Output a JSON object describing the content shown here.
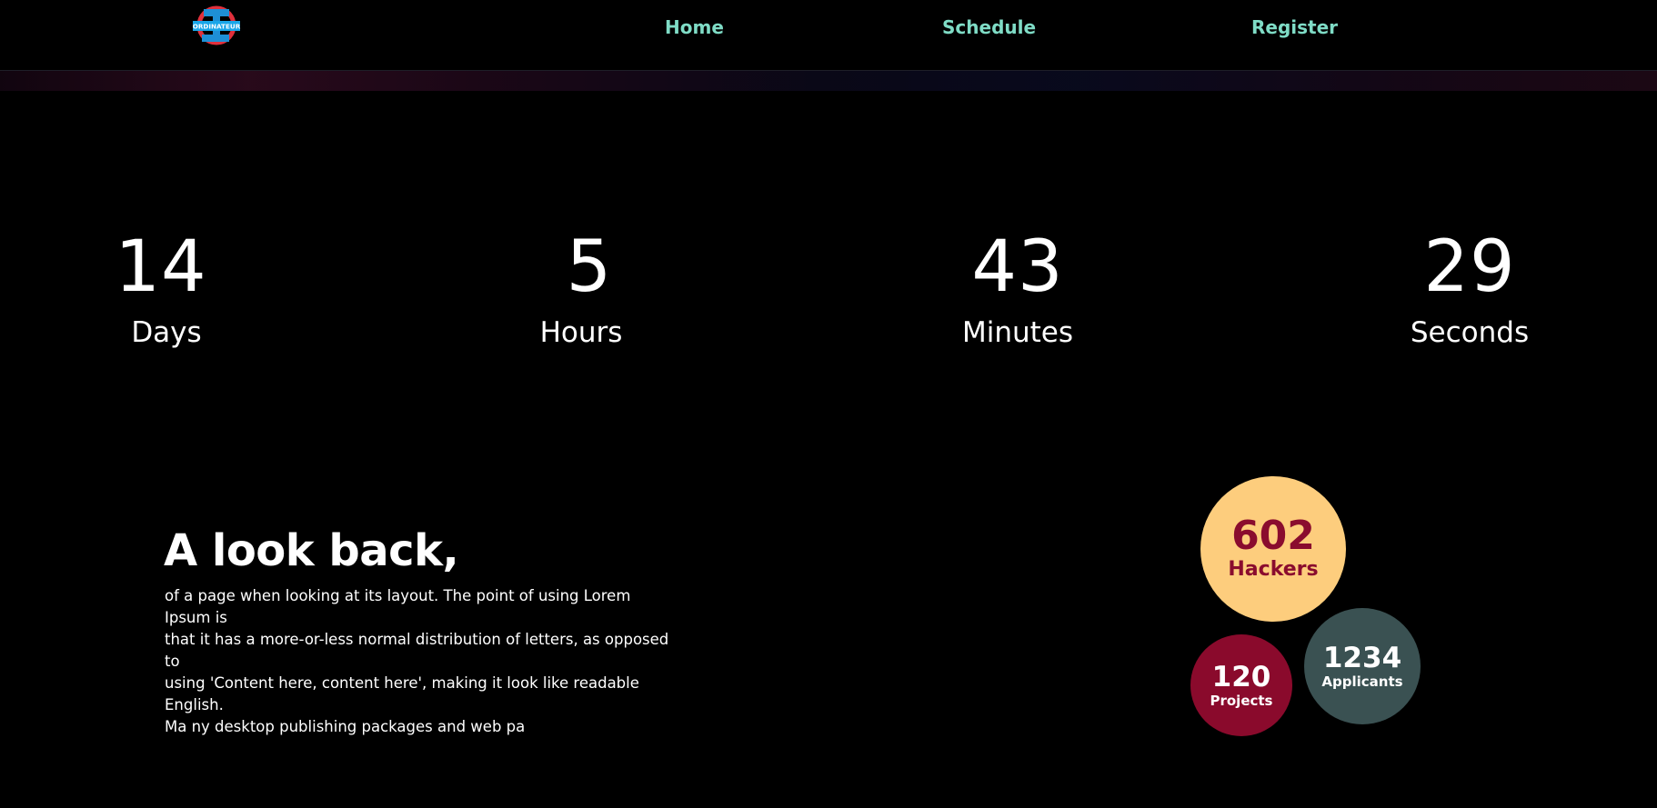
{
  "navbar": {
    "logo_text": "ORDINATEUR",
    "links": [
      {
        "label": "Home"
      },
      {
        "label": "Schedule"
      },
      {
        "label": "Register"
      }
    ]
  },
  "countdown": [
    {
      "value": "14",
      "label": "Days"
    },
    {
      "value": "5",
      "label": "Hours"
    },
    {
      "value": "43",
      "label": "Minutes"
    },
    {
      "value": "29",
      "label": "Seconds"
    }
  ],
  "lookback": {
    "title": "A look back,",
    "body_lines": [
      "of a page when looking at its layout. The point of using Lorem Ipsum is",
      "that it has a more-or-less normal distribution of letters, as opposed to",
      "using 'Content here, content here', making it look like readable English.",
      "Ma ny desktop publishing packages and web pa"
    ]
  },
  "stats": {
    "hackers": {
      "value": "602",
      "label": "Hackers"
    },
    "projects": {
      "value": "120",
      "label": "Projects"
    },
    "applicants": {
      "value": "1234",
      "label": "Applicants"
    }
  },
  "colors": {
    "background": "#000000",
    "nav_link": "#7fdcc6",
    "hackers_bubble": "#fdcd7d",
    "hackers_text": "#8a0c2e",
    "projects_bubble": "#8a0a2c",
    "applicants_bubble": "#3a5152"
  }
}
